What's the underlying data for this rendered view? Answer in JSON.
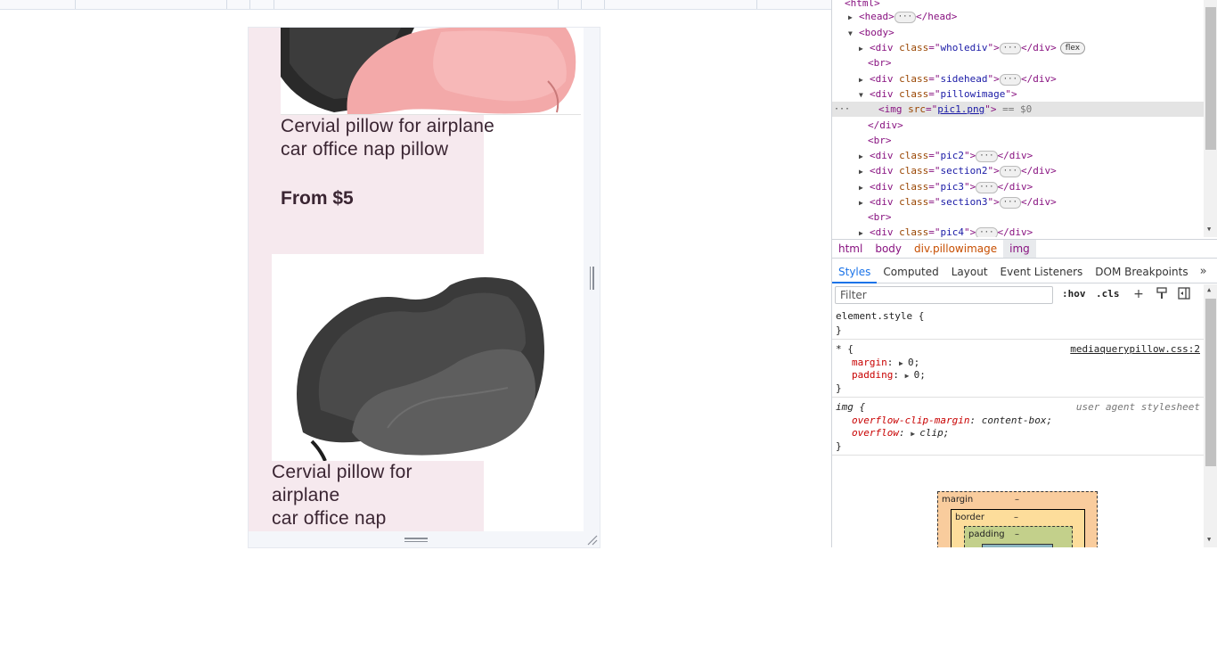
{
  "product_page": {
    "products": [
      {
        "title_line1": "Cervial pillow for airplane",
        "title_line2": "car office nap pillow",
        "price": "From $5",
        "image_color": "pink"
      },
      {
        "title_line1": "Cervial pillow for",
        "title_line2": "airplane",
        "title_line3": "car office nap",
        "image_color": "gray"
      }
    ]
  },
  "devtools": {
    "elements": {
      "lines": {
        "html_open": "<html>",
        "head": {
          "open": "<head>",
          "close": "</head>"
        },
        "body_open": "<body>",
        "wholediv": {
          "class": "wholediv",
          "badge": "flex"
        },
        "br": "<br>",
        "sidehead": {
          "class": "sidehead"
        },
        "pillowimage": {
          "class": "pillowimage"
        },
        "img": {
          "src": "pic1.png",
          "suffix": "== $0"
        },
        "div_close": "</div>",
        "pic2": {
          "class": "pic2"
        },
        "section2": {
          "class": "section2"
        },
        "pic3": {
          "class": "pic3"
        },
        "section3": {
          "class": "section3"
        },
        "pic4": {
          "class": "pic4"
        }
      }
    },
    "breadcrumbs": [
      "html",
      "body",
      "div.pillowimage",
      "img"
    ],
    "tabs": [
      "Styles",
      "Computed",
      "Layout",
      "Event Listeners",
      "DOM Breakpoints"
    ],
    "active_tab": "Styles",
    "filter": {
      "placeholder": "Filter",
      "hov": ":hov",
      "cls": ".cls"
    },
    "styles": {
      "element_style": {
        "selector": "element.style {",
        "close": "}"
      },
      "universal": {
        "selector": "* {",
        "source": "mediaquerypillow.css:2",
        "props": [
          {
            "name": "margin",
            "value": "0;"
          },
          {
            "name": "padding",
            "value": "0;"
          }
        ],
        "close": "}"
      },
      "img_ua": {
        "selector": "img {",
        "source": "user agent stylesheet",
        "props": [
          {
            "name": "overflow-clip-margin",
            "value": "content-box;"
          },
          {
            "name": "overflow",
            "value": "clip;"
          }
        ],
        "close": "}"
      }
    },
    "box_model": {
      "margin": "margin",
      "border": "border",
      "padding": "padding",
      "dash": "–"
    }
  },
  "colors": {
    "pink_bg": "#f6e9ee",
    "title_text": "#3a2532",
    "tag": "#881280",
    "attr_name": "#994500",
    "attr_value": "#1a1aa6",
    "active_tab": "#1a73e8"
  }
}
